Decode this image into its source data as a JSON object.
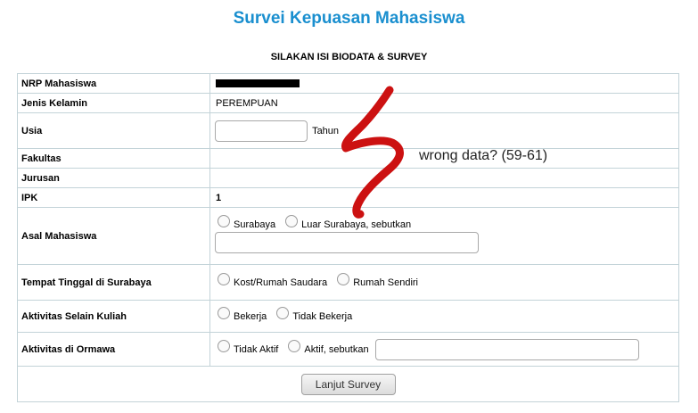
{
  "page": {
    "title": "Survei Kepuasan Mahasiswa",
    "subtitle": "SILAKAN ISI BIODATA & SURVEY"
  },
  "form": {
    "nrp": {
      "label": "NRP Mahasiswa",
      "value_redacted": true
    },
    "jenis_kelamin": {
      "label": "Jenis Kelamin",
      "value": "PEREMPUAN"
    },
    "usia": {
      "label": "Usia",
      "input_value": "",
      "unit": "Tahun"
    },
    "fakultas": {
      "label": "Fakultas",
      "value": ""
    },
    "jurusan": {
      "label": "Jurusan",
      "value": ""
    },
    "ipk": {
      "label": "IPK",
      "value": "1"
    },
    "asal": {
      "label": "Asal Mahasiswa",
      "options": [
        "Surabaya",
        "Luar Surabaya, sebutkan"
      ],
      "other_input": ""
    },
    "tempat_tinggal": {
      "label": "Tempat Tinggal di Surabaya",
      "options": [
        "Kost/Rumah Saudara",
        "Rumah Sendiri"
      ]
    },
    "aktivitas": {
      "label": "Aktivitas Selain Kuliah",
      "options": [
        "Bekerja",
        "Tidak Bekerja"
      ]
    },
    "ormawa": {
      "label": "Aktivitas di Ormawa",
      "options": [
        "Tidak Aktif",
        "Aktif, sebutkan"
      ],
      "other_input": ""
    },
    "submit_label": "Lanjut Survey"
  },
  "annotation": {
    "text": "wrong data? (59-61)",
    "color": "#cc1111"
  }
}
